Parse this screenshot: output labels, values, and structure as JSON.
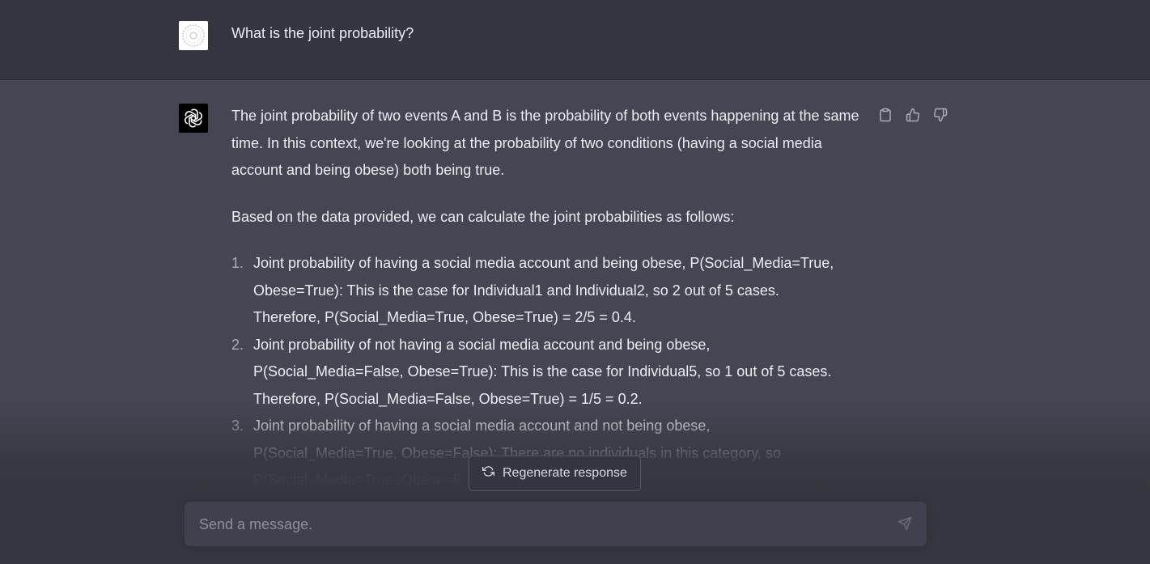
{
  "user_message": {
    "text": "What is the joint probability?"
  },
  "assistant_message": {
    "paragraphs": [
      "The joint probability of two events A and B is the probability of both events happening at the same time. In this context, we're looking at the probability of two conditions (having a social media account and being obese) both being true.",
      "Based on the data provided, we can calculate the joint probabilities as follows:"
    ],
    "list_items": [
      {
        "number": "1.",
        "line1": "Joint probability of having a social media account and being obese, P(Social_Media=True,",
        "line2": "Obese=True): This is the case for Individual1 and Individual2, so 2 out of 5 cases.",
        "line3": "Therefore, P(Social_Media=True, Obese=True) = 2/5 = 0.4."
      },
      {
        "number": "2.",
        "line1": "Joint probability of not having a social media account and being obese,",
        "line2": "P(Social_Media=False, Obese=True): This is the case for Individual5, so 1 out of 5 cases.",
        "line3": "Therefore, P(Social_Media=False, Obese=True) = 1/5 = 0.2."
      },
      {
        "number": "3.",
        "line1": "Joint probability of having a social media account and not being obese,",
        "line2": "P(Social_Media=True, Obese=False): There are no individuals in this category, so",
        "line3": "P(Social_Media=True, Obese=F"
      }
    ],
    "icons": [
      "clipboard-icon",
      "thumbs-up-icon",
      "thumbs-down-icon"
    ]
  },
  "regenerate": {
    "label": "Regenerate response"
  },
  "composer": {
    "placeholder": "Send a message."
  },
  "colors": {
    "user_bg": "#343541",
    "assistant_bg": "#444654",
    "input_bg": "#40414f",
    "text": "#ececf1"
  }
}
